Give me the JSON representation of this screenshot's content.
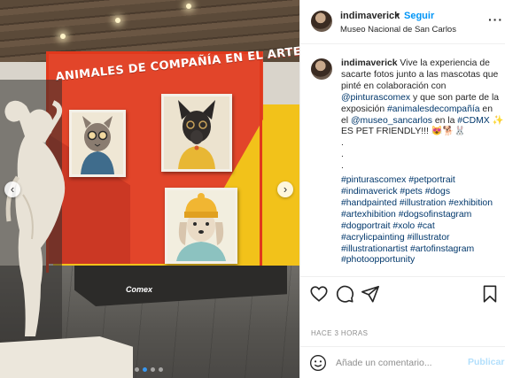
{
  "post": {
    "username": "indimaverick",
    "follow_label": "Seguir",
    "location": "Museo Nacional de San Carlos",
    "more_icon": "more-options-icon",
    "photo": {
      "exhibit_title": "ANIMALES DE COMPAÑÍA EN EL ARTE",
      "sponsor": "Comex",
      "slide_count": 4,
      "active_slide": 1
    },
    "caption": {
      "username": "indimaverick",
      "lines": [
        {
          "text": " Vive la experiencia de",
          "type": "user-lead"
        },
        {
          "text": "sacarte fotos junto a las mascotas que",
          "type": "text"
        },
        {
          "text": "pinté en colaboración con",
          "type": "text"
        },
        {
          "mention1": "@pinturascomex",
          "rest": " y que son parte de la",
          "type": "mention"
        },
        {
          "text": "exposición ",
          "tag": "#animalesdecompañía",
          "rest": " en",
          "type": "tag"
        },
        {
          "text": "el ",
          "mention2": "@museo_sancarlos",
          "rest": " en la ",
          "tag2": "#CDMX",
          "emoji": " ✨",
          "type": "mix"
        },
        {
          "text": "ES PET FRIENDLY!!! 😻🐕🐰",
          "type": "text"
        }
      ],
      "dots": [
        ".",
        ".",
        "."
      ],
      "hashtags": [
        "#pinturascomex #petportrait",
        "#indimaverick #pets #dogs",
        "#handpainted #illustration #exhibition",
        "#artexhibition #dogsofinstagram",
        "#dogportrait #xolo #cat",
        "#acrylicpainting #illustrator",
        "#illustrationartist #artofinstagram",
        "#photoopportunity"
      ]
    },
    "actions": {
      "like_icon": "heart-icon",
      "comment_icon": "comment-icon",
      "share_icon": "share-icon",
      "save_icon": "bookmark-icon"
    },
    "time_ago": "HACE 3 HORAS",
    "comment": {
      "placeholder": "Añade un comentario...",
      "publish_label": "Publicar"
    }
  }
}
